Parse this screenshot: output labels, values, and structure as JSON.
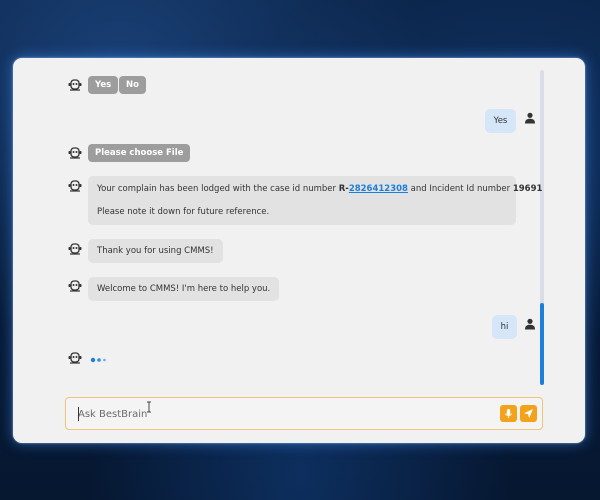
{
  "chat": {
    "quick_replies": [
      "Yes",
      "No"
    ],
    "user_reply_1": "Yes",
    "choose_file_label": "Please choose File",
    "complaint": {
      "line1_prefix": "Your complain has been lodged with the case id number ",
      "case_prefix": "R-",
      "case_id": "2826412308",
      "line1_mid": " and Incident Id number ",
      "incident_id": "19691",
      "line2": "Please note it down for future reference."
    },
    "thanks": "Thank you for using CMMS!",
    "welcome": "Welcome to CMMS! I'm here to help you.",
    "user_reply_2": "hi"
  },
  "input": {
    "placeholder": "Ask BestBrain",
    "value": ""
  },
  "icons": {
    "bot": "robot-icon",
    "user": "user-icon",
    "mic": "microphone-icon",
    "send": "send-icon",
    "typing": "typing-indicator"
  },
  "colors": {
    "accent": "#1e7fd8",
    "button": "#f3a21b",
    "chip": "#9d9d9d",
    "bot_bubble": "#e2e2e2",
    "user_bubble": "#d5e6f8",
    "panel": "#f1f1f1"
  }
}
